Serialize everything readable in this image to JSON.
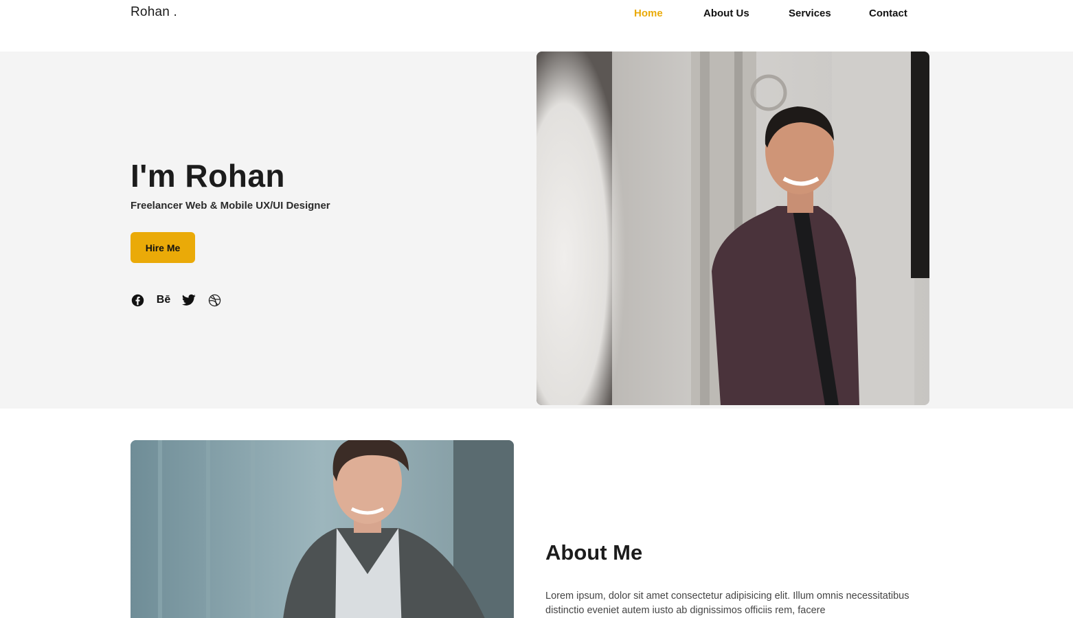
{
  "nav": {
    "brand": "Rohan .",
    "links": [
      {
        "label": "Home",
        "active": true
      },
      {
        "label": "About Us",
        "active": false
      },
      {
        "label": "Services",
        "active": false
      },
      {
        "label": "Contact",
        "active": false
      }
    ]
  },
  "hero": {
    "title": "I'm Rohan",
    "subtitle": "Freelancer Web & Mobile UX/UI Designer",
    "cta_label": "Hire Me",
    "socials": [
      {
        "icon": "facebook-icon"
      },
      {
        "icon": "behance-icon",
        "glyph": "Bē"
      },
      {
        "icon": "twitter-icon"
      },
      {
        "icon": "dribbble-icon"
      }
    ]
  },
  "about": {
    "title": "About Me",
    "text": "Lorem ipsum, dolor sit amet consectetur adipisicing elit. Illum omnis necessitatibus distinctio eveniet autem iusto ab dignissimos officiis rem, facere"
  },
  "colors": {
    "accent": "#eaaa08",
    "hero_bg": "#f4f4f4",
    "text": "#1c1c1c"
  }
}
